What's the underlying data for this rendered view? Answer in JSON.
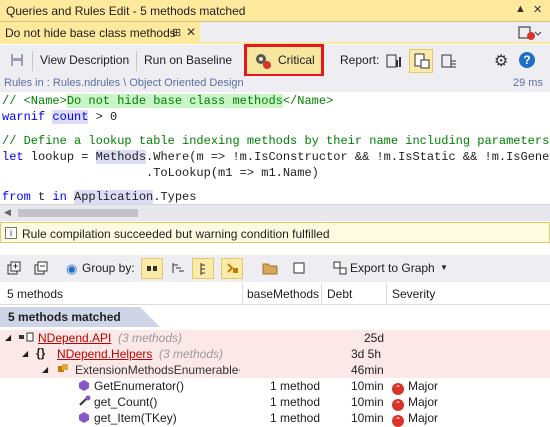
{
  "window": {
    "title": "Queries and Rules Edit  - 5 methods matched",
    "title_icons": [
      "pin-icon",
      "close-icon"
    ]
  },
  "doc_tab": {
    "label": "Do not hide base class methods",
    "pin_icon": "pin-icon",
    "close_icon": "close-icon",
    "menu_icon": "dropdown-menu-icon"
  },
  "toolbar": {
    "save_icon": "save-icon",
    "view_description": "View Description",
    "run_on_baseline": "Run on Baseline",
    "critical": "Critical",
    "report_label": "Report:",
    "settings_icon": "gear-icon",
    "help_icon": "help-icon"
  },
  "path": {
    "text": "Rules in :    Rules.ndrules \\ Object Oriented Design",
    "timing": "29 ms"
  },
  "code": {
    "line1_prefix": "// <Name>",
    "line1_name": "Do not hide base class methods",
    "line1_suffix": "</Name>",
    "line2_kw": "warnif ",
    "line2_hl": "count",
    "line2_rest": " > 0",
    "line4": "// Define a lookup table indexing methods by their name including parameters",
    "line5_kw": "let",
    "line5_a": " lookup = ",
    "line5_hl": "Methods",
    "line5_b": ".Where(m => !m.IsConstructor && !m.IsStatic && !m.IsGene",
    "line6": "                    .ToLookup(m1 => m1.Name)",
    "line8_kw1": "from",
    "line8_a": " t ",
    "line8_kw2": "in",
    "line8_sp": " ",
    "line8_hl": "Application",
    "line8_b": ".Types"
  },
  "status": {
    "message": "Rule compilation succeeded but warning condition fulfilled"
  },
  "results_toolbar": {
    "group_by": "Group by:",
    "export": "Export to Graph"
  },
  "grid": {
    "headers": [
      "5 methods",
      "baseMethods",
      "Debt",
      "Severity"
    ],
    "group_label": "5 methods matched",
    "rows": [
      {
        "name": "NDepend.API",
        "note": "(3 methods)",
        "base": "",
        "debt": "25d",
        "severity": ""
      },
      {
        "name": "NDepend.Helpers",
        "note": "(3 methods)",
        "base": "",
        "debt": "3d  5h",
        "severity": ""
      },
      {
        "name": "ExtensionMethodsEnumerable+Di",
        "note": "",
        "base": "",
        "debt": "46min",
        "severity": ""
      },
      {
        "name": "GetEnumerator()",
        "note": "",
        "base": "1 method",
        "debt": "10min",
        "severity": "Major"
      },
      {
        "name": "get_Count()",
        "note": "",
        "base": "1 method",
        "debt": "10min",
        "severity": "Major"
      },
      {
        "name": "get_Item(TKey)",
        "note": "",
        "base": "1 method",
        "debt": "10min",
        "severity": "Major"
      }
    ]
  },
  "colors": {
    "title_bar": "#ffe99d",
    "critical_border": "#e5191d",
    "comment": "#008000",
    "keyword": "#0000ff",
    "major": "#d9342b"
  }
}
